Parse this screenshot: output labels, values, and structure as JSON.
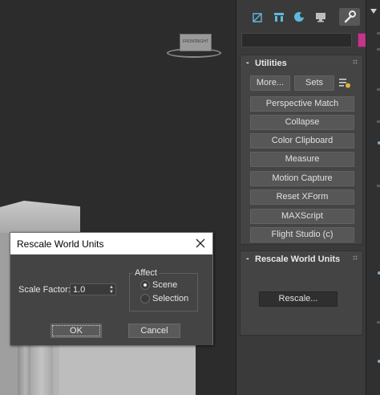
{
  "viewport": {
    "viewcube_labels": {
      "front": "FRONT",
      "right": "RIGHT"
    }
  },
  "dialog": {
    "title": "Rescale World Units",
    "scale_factor_label": "Scale Factor:",
    "scale_factor_value": "1.0",
    "affect_label": "Affect",
    "options": [
      {
        "label": "Scene",
        "selected": true
      },
      {
        "label": "Selection",
        "selected": false
      }
    ],
    "ok_label": "OK",
    "cancel_label": "Cancel"
  },
  "panel": {
    "tabs": [
      "create-icon",
      "modify-icon",
      "hierarchy-icon",
      "motion-icon",
      "display-icon",
      "utilities-icon"
    ],
    "active_tab": "utilities-icon",
    "swatch_color": "#c2358b",
    "utilities": {
      "sign": "-",
      "title": "Utilities",
      "more_label": "More...",
      "sets_label": "Sets",
      "buttons": [
        "Perspective Match",
        "Collapse",
        "Color Clipboard",
        "Measure",
        "Motion Capture",
        "Reset XForm",
        "MAXScript",
        "Flight Studio (c)"
      ]
    },
    "rescale": {
      "sign": "-",
      "title": "Rescale World Units",
      "button_label": "Rescale..."
    }
  }
}
